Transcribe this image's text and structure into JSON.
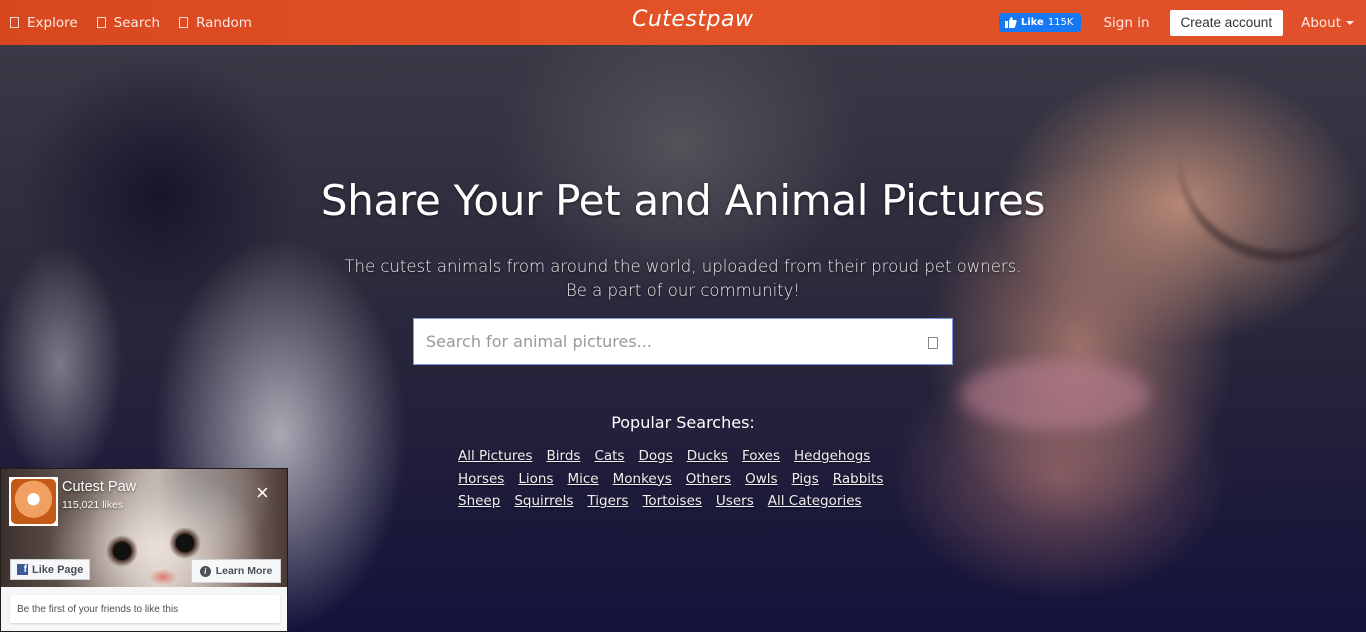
{
  "nav": {
    "left_links": [
      {
        "label": "Explore",
        "icon": "compass-icon"
      },
      {
        "label": "Search",
        "icon": "search-icon"
      },
      {
        "label": "Random",
        "icon": "shuffle-icon"
      }
    ],
    "logo": "Cutestpaw",
    "fb_like": {
      "label": "Like",
      "count": "115K"
    },
    "sign_in": "Sign in",
    "create_account": "Create account",
    "about": "About"
  },
  "hero": {
    "title": "Share Your Pet and Animal Pictures",
    "subtitle_line1": "The cutest animals from around the world, uploaded from their proud pet owners.",
    "subtitle_line2": "Be a part of our community!",
    "search": {
      "placeholder": "Search for animal pictures...",
      "value": ""
    },
    "popular_title": "Popular Searches:",
    "popular_rows": [
      [
        "All Pictures",
        "Birds",
        "Cats",
        "Dogs",
        "Ducks",
        "Foxes",
        "Hedgehogs"
      ],
      [
        "Horses",
        "Lions",
        "Mice",
        "Monkeys",
        "Others",
        "Owls",
        "Pigs",
        "Rabbits"
      ],
      [
        "Sheep",
        "Squirrels",
        "Tigers",
        "Tortoises",
        "Users",
        "All Categories"
      ]
    ]
  },
  "fb_widget": {
    "page_name": "Cutest Paw",
    "likes": "115,021 likes",
    "close": "×",
    "like_page": "Like Page",
    "learn_more": "Learn More",
    "friends_text": "Be the first of your friends to like this"
  }
}
